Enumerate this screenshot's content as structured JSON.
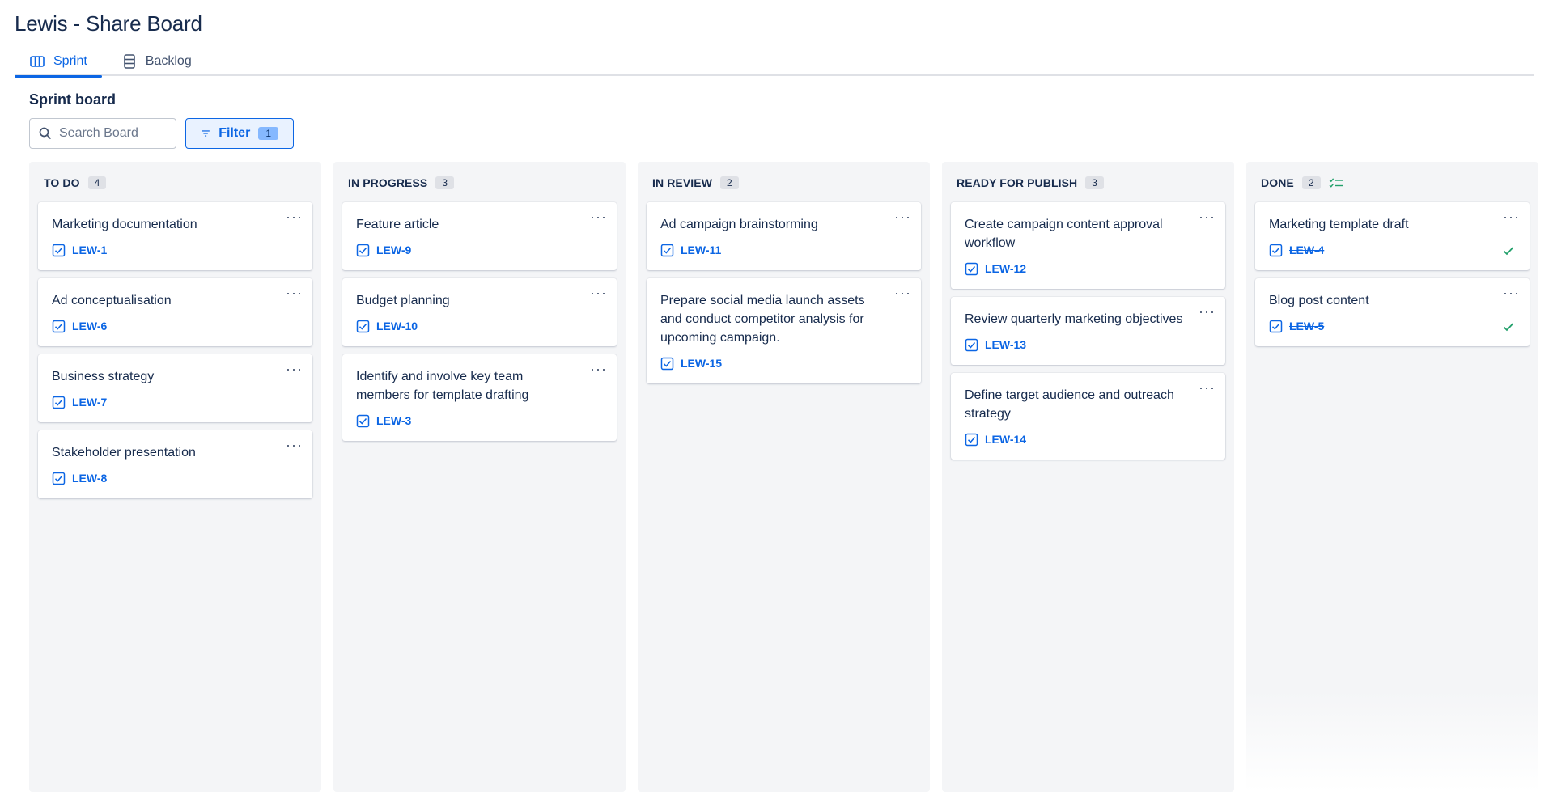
{
  "page": {
    "title": "Lewis - Share Board"
  },
  "tabs": [
    {
      "label": "Sprint",
      "icon": "board-columns-icon",
      "active": true
    },
    {
      "label": "Backlog",
      "icon": "backlog-list-icon",
      "active": false
    }
  ],
  "board": {
    "title": "Sprint board",
    "search": {
      "placeholder": "Search Board",
      "value": ""
    },
    "filter": {
      "label": "Filter",
      "count": "1"
    }
  },
  "colors": {
    "accent": "#0c66e4",
    "column_bg": "#f4f5f7",
    "done_green": "#22a06b"
  },
  "columns": [
    {
      "title": "TO DO",
      "count": "4",
      "cards": [
        {
          "title": "Marketing documentation",
          "key": "LEW-1"
        },
        {
          "title": "Ad conceptualisation",
          "key": "LEW-6"
        },
        {
          "title": "Business strategy",
          "key": "LEW-7"
        },
        {
          "title": "Stakeholder presentation",
          "key": "LEW-8"
        }
      ]
    },
    {
      "title": "IN PROGRESS",
      "count": "3",
      "cards": [
        {
          "title": "Feature article",
          "key": "LEW-9"
        },
        {
          "title": "Budget planning",
          "key": "LEW-10"
        },
        {
          "title": "Identify and involve key team members for template drafting",
          "key": "LEW-3"
        }
      ]
    },
    {
      "title": "IN REVIEW",
      "count": "2",
      "cards": [
        {
          "title": "Ad campaign brainstorming",
          "key": "LEW-11"
        },
        {
          "title": "Prepare social media launch assets and conduct competitor analysis for upcoming campaign.",
          "key": "LEW-15"
        }
      ]
    },
    {
      "title": "READY FOR PUBLISH",
      "count": "3",
      "cards": [
        {
          "title": "Create campaign content approval workflow",
          "key": "LEW-12"
        },
        {
          "title": "Review quarterly marketing objectives",
          "key": "LEW-13"
        },
        {
          "title": "Define target audience and outreach strategy",
          "key": "LEW-14"
        }
      ]
    },
    {
      "title": "DONE",
      "count": "2",
      "cards": [
        {
          "title": "Marketing template draft",
          "key": "LEW-4",
          "done": true
        },
        {
          "title": "Blog post content",
          "key": "LEW-5",
          "done": true
        }
      ]
    }
  ]
}
